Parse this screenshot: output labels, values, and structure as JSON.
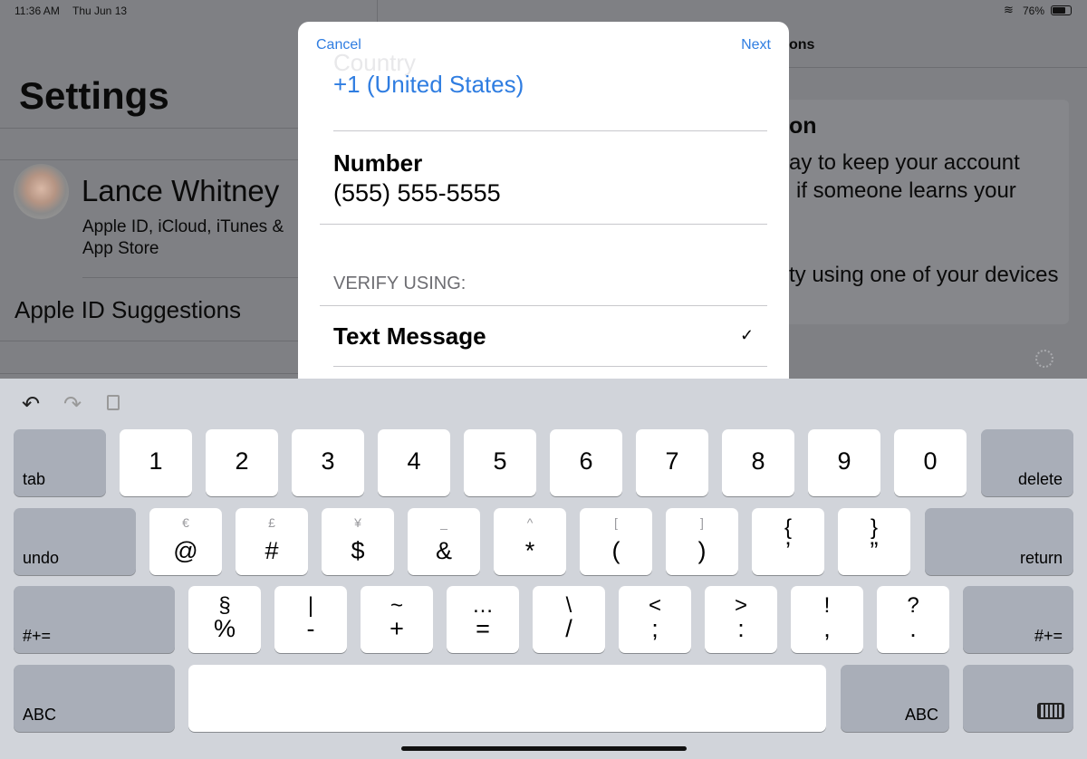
{
  "status_bar": {
    "time": "11:36 AM",
    "date": "Thu Jun 13",
    "battery": "76%",
    "battery_level": 0.76
  },
  "settings": {
    "title": "Settings",
    "profile_name": "Lance Whitney",
    "profile_sub_line1": "Apple ID, iCloud, iTunes &",
    "profile_sub_line2": "App Store",
    "suggestions": "Apple ID Suggestions"
  },
  "detail": {
    "nav_fragment": "ons",
    "heading_fragment": "on",
    "line1": "ay to keep your account",
    "line2": "if someone learns your",
    "line3": "ty using one of your devices"
  },
  "modal": {
    "cancel": "Cancel",
    "next": "Next",
    "country_label": "Country",
    "country_value": "+1 (United States)",
    "number_label": "Number",
    "number_value": "(555) 555-5555",
    "verify_header": "VERIFY USING:",
    "text_message": "Text Message",
    "check": "✓",
    "accent": "#2f7de1"
  },
  "keyboard": {
    "row1": [
      "1",
      "2",
      "3",
      "4",
      "5",
      "6",
      "7",
      "8",
      "9",
      "0"
    ],
    "row2": [
      [
        "€",
        "@"
      ],
      [
        "£",
        "#"
      ],
      [
        "¥",
        "$"
      ],
      [
        "_",
        "&"
      ],
      [
        "^",
        "*"
      ],
      [
        "[",
        "("
      ],
      [
        "]",
        ")"
      ],
      [
        "{",
        "’"
      ],
      [
        "}",
        "”"
      ]
    ],
    "row3": [
      [
        "§",
        "%"
      ],
      [
        "|",
        "-"
      ],
      [
        "~",
        "+"
      ],
      [
        "…",
        "="
      ],
      [
        "\\",
        "/"
      ],
      [
        "<",
        ";"
      ],
      [
        ">",
        ":"
      ],
      [
        "!",
        ","
      ],
      [
        "?",
        "."
      ]
    ],
    "tab": "tab",
    "delete": "delete",
    "undo": "undo",
    "return": "return",
    "symbols_left": "#+=",
    "symbols_right": "#+=",
    "abc_left": "ABC",
    "abc_right": "ABC"
  }
}
